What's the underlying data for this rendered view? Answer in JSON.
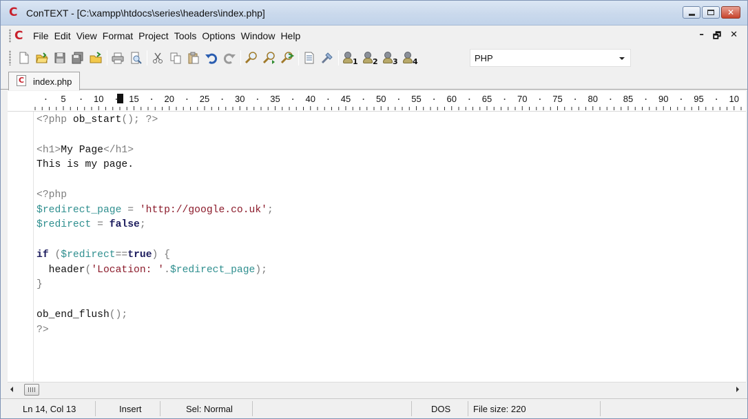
{
  "window": {
    "title": "ConTEXT - [C:\\xampp\\htdocs\\series\\headers\\index.php]",
    "app_logo": "C"
  },
  "menu": {
    "items": [
      "File",
      "Edit",
      "View",
      "Format",
      "Project",
      "Tools",
      "Options",
      "Window",
      "Help"
    ],
    "mdi_minimize": "–",
    "mdi_restore": "🗗",
    "mdi_close": "✕"
  },
  "toolbar": {
    "icons": [
      "new-file-icon",
      "open-folder-icon",
      "save-icon",
      "save-all-icon",
      "open-project-icon",
      "print-icon",
      "print-preview-icon",
      "cut-icon",
      "copy-icon",
      "paste-icon",
      "undo-icon",
      "redo-icon",
      "find-icon",
      "find-next-icon",
      "replace-icon",
      "file-info-icon",
      "tool-icon"
    ],
    "bookmarks": [
      "1",
      "2",
      "3",
      "4"
    ],
    "highlighter": "PHP"
  },
  "tabs": [
    {
      "label": "index.php",
      "icon": "php-file-icon"
    }
  ],
  "ruler": {
    "labels": [
      "5",
      "10",
      "15",
      "20",
      "25",
      "30",
      "35",
      "40",
      "45",
      "50",
      "55",
      "60",
      "65",
      "70",
      "75",
      "80",
      "85",
      "90",
      "95",
      "10"
    ],
    "cursor_column": 13
  },
  "code_lines": [
    [
      {
        "t": "<?php",
        "c": "ph"
      },
      {
        "t": " ob_start",
        "c": "fn"
      },
      {
        "t": "();",
        "c": "op"
      },
      {
        "t": " ?>",
        "c": "ph"
      }
    ],
    [],
    [
      {
        "t": "<h1>",
        "c": "tag"
      },
      {
        "t": "My Page",
        "c": "txt"
      },
      {
        "t": "</h1>",
        "c": "tag"
      }
    ],
    [
      {
        "t": "This is my page.",
        "c": "txt"
      }
    ],
    [],
    [
      {
        "t": "<?php",
        "c": "ph"
      }
    ],
    [
      {
        "t": "$redirect_page",
        "c": "var"
      },
      {
        "t": " = ",
        "c": "op"
      },
      {
        "t": "'http://google.co.uk'",
        "c": "str"
      },
      {
        "t": ";",
        "c": "op"
      }
    ],
    [
      {
        "t": "$redirect",
        "c": "var"
      },
      {
        "t": " = ",
        "c": "op"
      },
      {
        "t": "false",
        "c": "kw"
      },
      {
        "t": ";",
        "c": "op"
      }
    ],
    [],
    [
      {
        "t": "if",
        "c": "kw"
      },
      {
        "t": " (",
        "c": "op"
      },
      {
        "t": "$redirect",
        "c": "var"
      },
      {
        "t": "==",
        "c": "op"
      },
      {
        "t": "true",
        "c": "kw"
      },
      {
        "t": ") {",
        "c": "op"
      }
    ],
    [
      {
        "t": "  header",
        "c": "fn"
      },
      {
        "t": "(",
        "c": "op"
      },
      {
        "t": "'Location: '",
        "c": "str"
      },
      {
        "t": ".",
        "c": "op"
      },
      {
        "t": "$redirect_page",
        "c": "var"
      },
      {
        "t": ");",
        "c": "op"
      }
    ],
    [
      {
        "t": "}",
        "c": "op"
      }
    ],
    [],
    [
      {
        "t": "ob_end_flush",
        "c": "fn"
      },
      {
        "t": "();",
        "c": "op"
      }
    ],
    [
      {
        "t": "?>",
        "c": "ph"
      }
    ]
  ],
  "status": {
    "position": "Ln 14, Col 13",
    "mode": "Insert",
    "selection": "Sel: Normal",
    "empty": "",
    "line_endings": "DOS",
    "file_size": "File size: 220"
  },
  "colors": {
    "keyword": "#1d1d5e",
    "variable": "#2f8f8f",
    "string": "#8b1a2a",
    "php_tag": "#7d7d7d",
    "brand": "#c8202b"
  }
}
